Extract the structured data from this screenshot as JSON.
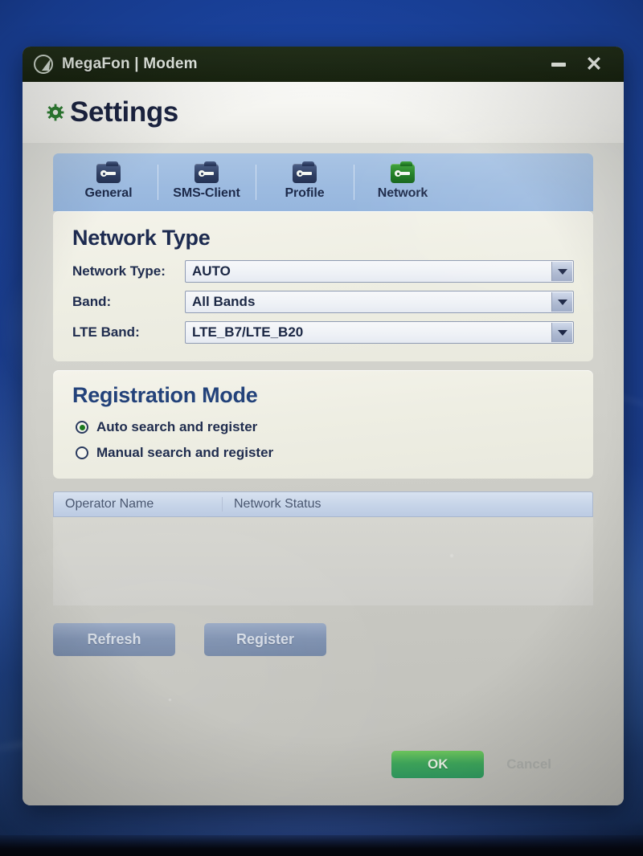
{
  "window": {
    "title": "MegaFon | Modem",
    "logo_icon": "megafon-circle-logo",
    "minimize_label": "–",
    "close_label": "✕"
  },
  "header": {
    "icon": "gear-icon",
    "title": "Settings"
  },
  "tabs": [
    {
      "label": "General",
      "icon": "folder-key-icon",
      "active": false
    },
    {
      "label": "SMS-Client",
      "icon": "folder-key-icon",
      "active": false
    },
    {
      "label": "Profile",
      "icon": "folder-key-icon",
      "active": false
    },
    {
      "label": "Network",
      "icon": "folder-key-icon",
      "active": true
    }
  ],
  "network_type": {
    "title": "Network Type",
    "fields": [
      {
        "label": "Network Type:",
        "value": "AUTO"
      },
      {
        "label": "Band:",
        "value": "All Bands"
      },
      {
        "label": "LTE Band:",
        "value": "LTE_B7/LTE_B20"
      }
    ]
  },
  "registration_mode": {
    "title": "Registration Mode",
    "options": [
      {
        "label": "Auto search and register",
        "selected": true
      },
      {
        "label": "Manual search and register",
        "selected": false
      }
    ]
  },
  "operator_table": {
    "columns": [
      "Operator Name",
      "Network Status"
    ],
    "rows": []
  },
  "actions": {
    "refresh_label": "Refresh",
    "register_label": "Register"
  },
  "footer": {
    "ok_label": "OK",
    "cancel_label": "Cancel"
  },
  "colors": {
    "titlebar": "#1e2a16",
    "accent_green": "#2f9a60",
    "tab_strip": "#9dbbe0",
    "card": "#eeeee3",
    "heading_navy": "#1d2b50",
    "desktop_blue": "#1b4094"
  }
}
